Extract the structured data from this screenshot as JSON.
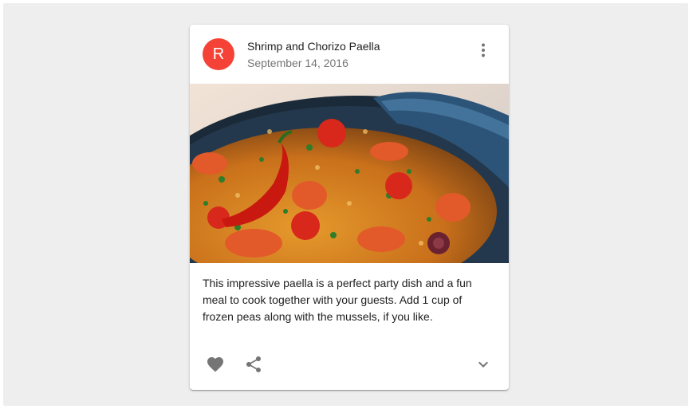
{
  "card": {
    "avatar_letter": "R",
    "title": "Shrimp and Chorizo Paella",
    "subheader": "September 14, 2016",
    "media_alt": "Paella dish",
    "body_text": "This impressive paella is a perfect party dish and a fun meal to cook together with your guests. Add 1 cup of frozen peas along with the mussels, if you like.",
    "icons": {
      "more": "more-vert-icon",
      "favorite": "favorite-icon",
      "share": "share-icon",
      "expand": "expand-more-icon"
    },
    "colors": {
      "avatar": "#f44336",
      "icon": "#757575",
      "background": "#eeeeee"
    }
  }
}
